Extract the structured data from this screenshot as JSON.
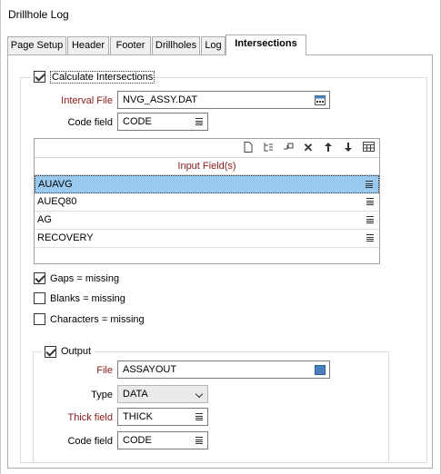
{
  "window": {
    "title": "Drillhole Log"
  },
  "tabs": [
    {
      "label": "Page Setup"
    },
    {
      "label": "Header"
    },
    {
      "label": "Footer"
    },
    {
      "label": "Drillholes"
    },
    {
      "label": "Log"
    },
    {
      "label": "Intersections"
    }
  ],
  "intersections": {
    "calculate_label": "Calculate Intersections",
    "calculate_checked": true,
    "interval_file_label": "Interval File",
    "interval_file_value": "NVG_ASSY.DAT",
    "code_field_label": "Code field",
    "code_field_value": "CODE",
    "grid": {
      "header": "Input Field(s)",
      "rows": [
        "AUAVG",
        "AUEQ80",
        "AG",
        "RECOVERY"
      ],
      "selected_index": 0
    },
    "gaps_label": "Gaps = missing",
    "gaps_checked": true,
    "blanks_label": "Blanks = missing",
    "blanks_checked": false,
    "characters_label": "Characters = missing",
    "characters_checked": false
  },
  "output": {
    "label": "Output",
    "checked": true,
    "file_label": "File",
    "file_value": "ASSAYOUT",
    "type_label": "Type",
    "type_value": "DATA",
    "thick_field_label": "Thick field",
    "thick_field_value": "THICK",
    "code_field_label": "Code field",
    "code_field_value": "CODE"
  },
  "colors": {
    "required_label": "#8b1a1a",
    "selection": "#99c9ef",
    "accent_icon": "#4a7fc1"
  }
}
